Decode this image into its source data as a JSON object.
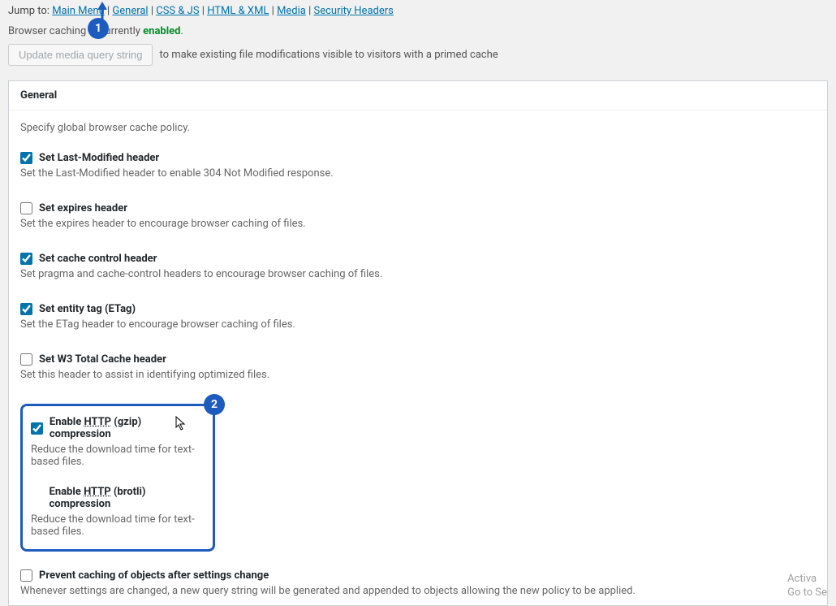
{
  "jump": {
    "prefix": "Jump to:",
    "links": [
      "Main Menu",
      "General",
      "CSS & JS",
      "HTML & XML",
      "Media",
      "Security Headers"
    ]
  },
  "status": {
    "prefix": "Browser caching is currently",
    "value": "enabled",
    "suffix": "."
  },
  "update": {
    "button": "Update media query string",
    "hint": "to make existing file modifications visible to visitors with a primed cache"
  },
  "section": {
    "title": "General",
    "intro": "Specify global browser cache policy."
  },
  "opts": {
    "lm": {
      "label": "Set Last-Modified header",
      "desc": "Set the Last-Modified header to enable 304 Not Modified response.",
      "checked": true
    },
    "exp": {
      "label": "Set expires header",
      "desc": "Set the expires header to encourage browser caching of files.",
      "checked": false
    },
    "cc": {
      "label": "Set cache control header",
      "desc": "Set pragma and cache-control headers to encourage browser caching of files.",
      "checked": true
    },
    "etag": {
      "label": "Set entity tag (ETag)",
      "desc": "Set the ETag header to encourage browser caching of files.",
      "checked": true
    },
    "w3": {
      "label": "Set W3 Total Cache header",
      "desc": "Set this header to assist in identifying optimized files.",
      "checked": false
    },
    "gzip": {
      "pre": "Enable ",
      "http": "HTTP",
      "post": " (gzip) compression",
      "desc": "Reduce the download time for text-based files.",
      "checked": true
    },
    "brotli": {
      "pre": "Enable ",
      "http": "HTTP",
      "post": " (brotli) compression",
      "desc": "Reduce the download time for text-based files.",
      "checked": false
    },
    "prevent": {
      "label": "Prevent caching of objects after settings change",
      "desc": "Whenever settings are changed, a new query string will be generated and appended to objects allowing the new policy to be applied.",
      "checked": false
    }
  },
  "markers": {
    "one": "1",
    "two": "2"
  },
  "watermark": {
    "l1": "Activa",
    "l2": "Go to Se"
  }
}
